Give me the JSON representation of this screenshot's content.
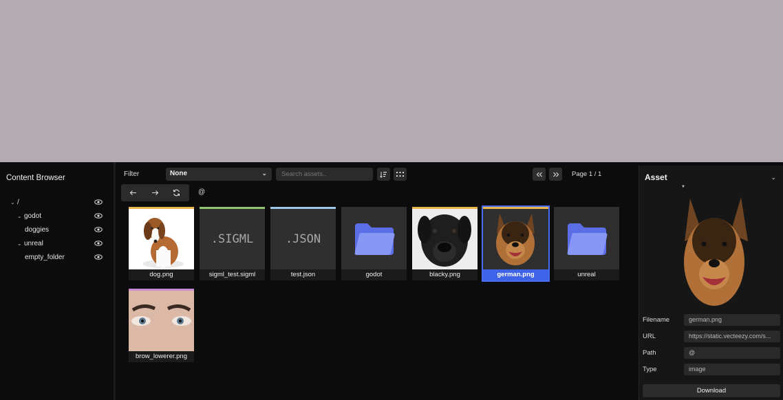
{
  "sidebar": {
    "title": "Content Browser",
    "tree": [
      {
        "label": "/",
        "expanded": true,
        "depth": 0
      },
      {
        "label": "godot",
        "expanded": true,
        "depth": 1
      },
      {
        "label": "doggies",
        "expanded": false,
        "depth": 2
      },
      {
        "label": "unreal",
        "expanded": true,
        "depth": 1
      },
      {
        "label": "empty_folder",
        "expanded": false,
        "depth": 2
      }
    ]
  },
  "toolbar": {
    "filter_label": "Filter",
    "filter_value": "None",
    "search_placeholder": "Search assets..",
    "page_label": "Page 1 / 1",
    "path_label": "@"
  },
  "assets": [
    {
      "name": "dog.png",
      "kind": "image",
      "accent": "#e8b64a"
    },
    {
      "name": "sigml_test.sigml",
      "kind": "file",
      "ext": ".SIGML",
      "accent": "#93c572"
    },
    {
      "name": "test.json",
      "kind": "file",
      "ext": ".JSON",
      "accent": "#9fc8e8"
    },
    {
      "name": "godot",
      "kind": "folder"
    },
    {
      "name": "blacky.png",
      "kind": "image",
      "accent": "#e8b64a"
    },
    {
      "name": "german.png",
      "kind": "image",
      "accent": "#e8b64a",
      "selected": true
    },
    {
      "name": "unreal",
      "kind": "folder"
    },
    {
      "name": "brow_lowerer.png",
      "kind": "image",
      "accent": "#c98ad6"
    }
  ],
  "details": {
    "title": "Asset",
    "fields": [
      {
        "label": "Filename",
        "value": "german.png"
      },
      {
        "label": "URL",
        "value": "https://static.vecteezy.com/s..."
      },
      {
        "label": "Path",
        "value": "@"
      },
      {
        "label": "Type",
        "value": "image"
      }
    ],
    "download_label": "Download"
  },
  "colors": {
    "accent_blue": "#3f63e8",
    "folder": "#6f7ff2",
    "viewport": "#b4aab1"
  }
}
